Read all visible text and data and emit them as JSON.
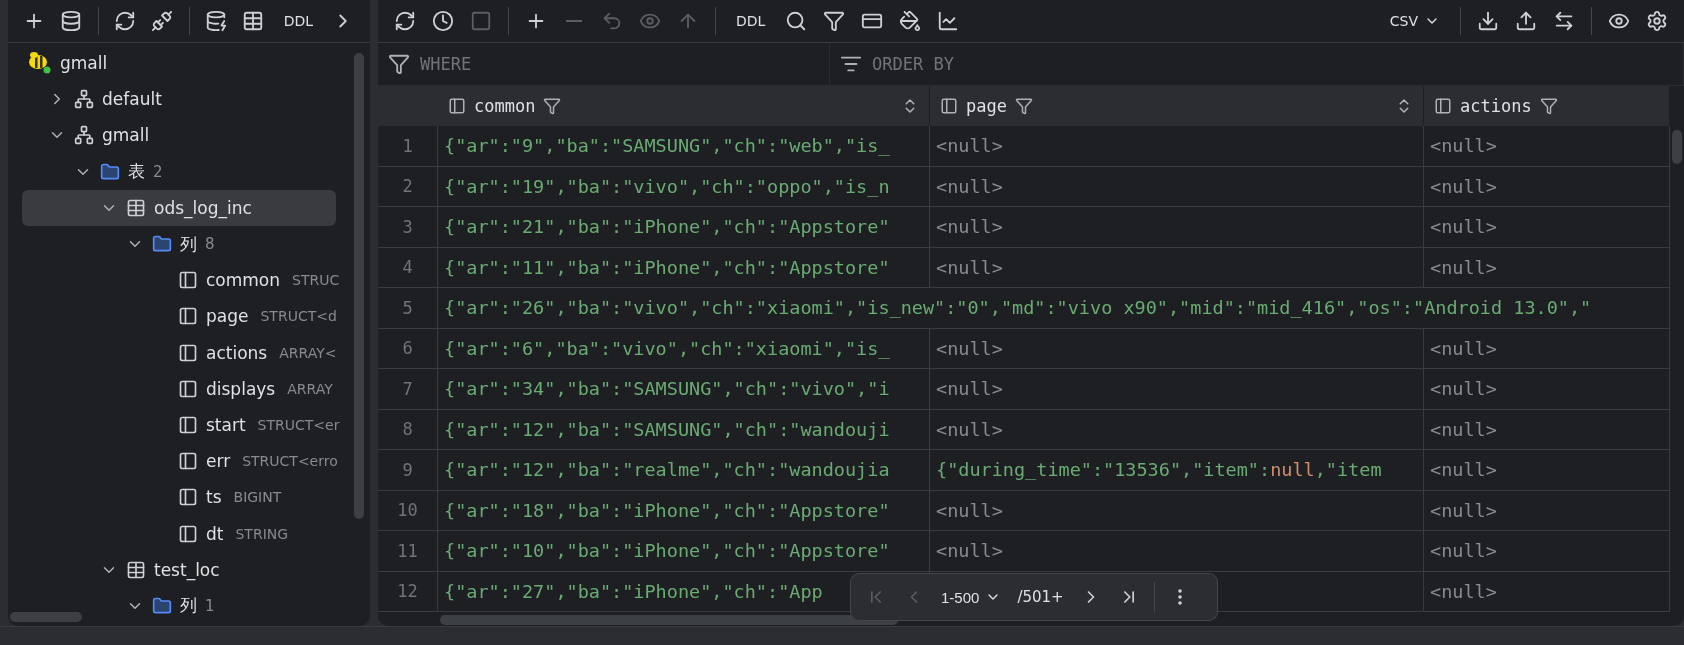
{
  "sidebar": {
    "toolbar": [
      {
        "kind": "icon"
      },
      {
        "kind": "icon"
      },
      {
        "kind": "divider"
      },
      {
        "kind": "icon"
      },
      {
        "kind": "icon"
      },
      {
        "kind": "divider"
      },
      {
        "kind": "icon"
      },
      {
        "kind": "icon"
      },
      {
        "kind": "text",
        "label": "DDL"
      },
      {
        "kind": "icon"
      }
    ],
    "tree": [
      {
        "kind": "database",
        "label": "gmall",
        "selected": false,
        "children": [
          {
            "kind": "schema",
            "label": "default",
            "expanded": false,
            "selected": false
          },
          {
            "kind": "schema",
            "label": "gmall",
            "expanded": true,
            "selected": false,
            "children": [
              {
                "kind": "folder",
                "label": "表",
                "count": "2",
                "expanded": true,
                "selected": false,
                "children": [
                  {
                    "kind": "table",
                    "label": "ods_log_inc",
                    "expanded": true,
                    "selected": true,
                    "children": [
                      {
                        "kind": "folder",
                        "label": "列",
                        "count": "8",
                        "expanded": true,
                        "selected": false,
                        "children": [
                          {
                            "kind": "column",
                            "label": "common",
                            "type": "STRUC",
                            "selected": false
                          },
                          {
                            "kind": "column",
                            "label": "page",
                            "type": "STRUCT<d",
                            "selected": false
                          },
                          {
                            "kind": "column",
                            "label": "actions",
                            "type": "ARRAY<",
                            "selected": false
                          },
                          {
                            "kind": "column",
                            "label": "displays",
                            "type": "ARRAY",
                            "selected": false
                          },
                          {
                            "kind": "column",
                            "label": "start",
                            "type": "STRUCT<er",
                            "selected": false
                          },
                          {
                            "kind": "column",
                            "label": "err",
                            "type": "STRUCT<erro",
                            "selected": false
                          },
                          {
                            "kind": "column",
                            "label": "ts",
                            "type": "BIGINT",
                            "selected": false
                          },
                          {
                            "kind": "column",
                            "label": "dt",
                            "type": "STRING",
                            "selected": false
                          }
                        ]
                      }
                    ]
                  },
                  {
                    "kind": "table",
                    "label": "test_loc",
                    "expanded": true,
                    "selected": false,
                    "children": [
                      {
                        "kind": "folder",
                        "label": "列",
                        "count": "1",
                        "expanded": true,
                        "selected": false
                      }
                    ]
                  }
                ]
              }
            ]
          }
        ]
      }
    ]
  },
  "toolbar": [
    {
      "kind": "icon",
      "disabled": false
    },
    {
      "kind": "icon",
      "disabled": false
    },
    {
      "kind": "icon",
      "disabled": true
    },
    {
      "kind": "divider"
    },
    {
      "kind": "icon",
      "disabled": false
    },
    {
      "kind": "icon",
      "disabled": true
    },
    {
      "kind": "icon",
      "disabled": true
    },
    {
      "kind": "icon",
      "disabled": true
    },
    {
      "kind": "icon",
      "disabled": true
    },
    {
      "kind": "divider"
    },
    {
      "kind": "text",
      "label": "DDL",
      "disabled": false
    },
    {
      "kind": "icon",
      "disabled": false
    },
    {
      "kind": "icon",
      "disabled": false
    },
    {
      "kind": "icon",
      "disabled": false
    },
    {
      "kind": "icon",
      "disabled": false
    },
    {
      "kind": "icon",
      "disabled": false
    },
    {
      "kind": "spacer"
    },
    {
      "kind": "dropdown",
      "label": "CSV",
      "disabled": false
    },
    {
      "kind": "divider"
    },
    {
      "kind": "icon",
      "disabled": false
    },
    {
      "kind": "icon",
      "disabled": false
    },
    {
      "kind": "icon",
      "disabled": false
    },
    {
      "kind": "divider"
    },
    {
      "kind": "icon",
      "disabled": false
    },
    {
      "kind": "icon",
      "disabled": false
    }
  ],
  "filters": {
    "where": {
      "placeholder": "WHERE"
    },
    "order_by": {
      "placeholder": "ORDER BY"
    }
  },
  "table": {
    "columns": [
      {
        "name": "common",
        "sortable": true
      },
      {
        "name": "page",
        "sortable": true
      },
      {
        "name": "actions",
        "sortable": false
      }
    ],
    "rows": [
      {
        "number": "1",
        "kind": "normal",
        "cells": [
          {
            "segments": [
              {
                "text": "{\"ar\":\"9\",\"ba\":\"SAMSUNG\",\"ch\":\"web\",\"is_",
                "kind": "json"
              }
            ]
          },
          {
            "segments": [
              {
                "text": "<null>",
                "kind": "null"
              }
            ]
          },
          {
            "segments": [
              {
                "text": "<null>",
                "kind": "null"
              }
            ]
          }
        ]
      },
      {
        "number": "2",
        "kind": "normal",
        "cells": [
          {
            "segments": [
              {
                "text": "{\"ar\":\"19\",\"ba\":\"vivo\",\"ch\":\"oppo\",\"is_n",
                "kind": "json"
              }
            ]
          },
          {
            "segments": [
              {
                "text": "<null>",
                "kind": "null"
              }
            ]
          },
          {
            "segments": [
              {
                "text": "<null>",
                "kind": "null"
              }
            ]
          }
        ]
      },
      {
        "number": "3",
        "kind": "normal",
        "cells": [
          {
            "segments": [
              {
                "text": "{\"ar\":\"21\",\"ba\":\"iPhone\",\"ch\":\"Appstore\"",
                "kind": "json"
              }
            ]
          },
          {
            "segments": [
              {
                "text": "<null>",
                "kind": "null"
              }
            ]
          },
          {
            "segments": [
              {
                "text": "<null>",
                "kind": "null"
              }
            ]
          }
        ]
      },
      {
        "number": "4",
        "kind": "normal",
        "cells": [
          {
            "segments": [
              {
                "text": "{\"ar\":\"11\",\"ba\":\"iPhone\",\"ch\":\"Appstore\"",
                "kind": "json"
              }
            ]
          },
          {
            "segments": [
              {
                "text": "<null>",
                "kind": "null"
              }
            ]
          },
          {
            "segments": [
              {
                "text": "<null>",
                "kind": "null"
              }
            ]
          }
        ]
      },
      {
        "number": "5",
        "kind": "wide",
        "cells": [
          {
            "segments": [
              {
                "text": "{\"ar\":\"26\",\"ba\":\"vivo\",\"ch\":\"xiaomi\",\"is_new\":\"0\",\"md\":\"vivo x90\",\"mid\":\"mid_416\",\"os\":\"Android 13.0\",\"",
                "kind": "json"
              }
            ]
          }
        ]
      },
      {
        "number": "6",
        "kind": "normal",
        "cells": [
          {
            "segments": [
              {
                "text": "{\"ar\":\"6\",\"ba\":\"vivo\",\"ch\":\"xiaomi\",\"is_",
                "kind": "json"
              }
            ]
          },
          {
            "segments": [
              {
                "text": "<null>",
                "kind": "null"
              }
            ]
          },
          {
            "segments": [
              {
                "text": "<null>",
                "kind": "null"
              }
            ]
          }
        ]
      },
      {
        "number": "7",
        "kind": "normal",
        "cells": [
          {
            "segments": [
              {
                "text": "{\"ar\":\"34\",\"ba\":\"SAMSUNG\",\"ch\":\"vivo\",\"i",
                "kind": "json"
              }
            ]
          },
          {
            "segments": [
              {
                "text": "<null>",
                "kind": "null"
              }
            ]
          },
          {
            "segments": [
              {
                "text": "<null>",
                "kind": "null"
              }
            ]
          }
        ]
      },
      {
        "number": "8",
        "kind": "normal",
        "cells": [
          {
            "segments": [
              {
                "text": "{\"ar\":\"12\",\"ba\":\"SAMSUNG\",\"ch\":\"wandouji",
                "kind": "json"
              }
            ]
          },
          {
            "segments": [
              {
                "text": "<null>",
                "kind": "null"
              }
            ]
          },
          {
            "segments": [
              {
                "text": "<null>",
                "kind": "null"
              }
            ]
          }
        ]
      },
      {
        "number": "9",
        "kind": "normal",
        "cells": [
          {
            "segments": [
              {
                "text": "{\"ar\":\"12\",\"ba\":\"realme\",\"ch\":\"wandoujia",
                "kind": "json"
              }
            ]
          },
          {
            "segments": [
              {
                "text": "{\"during_time\":\"13536\",\"item\":",
                "kind": "json"
              },
              {
                "text": "null",
                "kind": "literal"
              },
              {
                "text": ",\"item",
                "kind": "json"
              }
            ]
          },
          {
            "segments": [
              {
                "text": "<null>",
                "kind": "null"
              }
            ]
          }
        ]
      },
      {
        "number": "10",
        "kind": "normal",
        "cells": [
          {
            "segments": [
              {
                "text": "{\"ar\":\"18\",\"ba\":\"iPhone\",\"ch\":\"Appstore\"",
                "kind": "json"
              }
            ]
          },
          {
            "segments": [
              {
                "text": "<null>",
                "kind": "null"
              }
            ]
          },
          {
            "segments": [
              {
                "text": "<null>",
                "kind": "null"
              }
            ]
          }
        ]
      },
      {
        "number": "11",
        "kind": "normal",
        "cells": [
          {
            "segments": [
              {
                "text": "{\"ar\":\"10\",\"ba\":\"iPhone\",\"ch\":\"Appstore\"",
                "kind": "json"
              }
            ]
          },
          {
            "segments": [
              {
                "text": "<null>",
                "kind": "null"
              }
            ]
          },
          {
            "segments": [
              {
                "text": "<null>",
                "kind": "null"
              }
            ]
          }
        ]
      },
      {
        "number": "12",
        "kind": "normal",
        "cells": [
          {
            "segments": [
              {
                "text": "{\"ar\":\"27\",\"ba\":\"iPhone\",\"ch\":\"App",
                "kind": "json"
              }
            ]
          },
          "",
          {
            "segments": [
              {
                "text": "<null>",
                "kind": "null"
              }
            ]
          }
        ]
      }
    ]
  },
  "pagination": {
    "first": {
      "disabled": true
    },
    "previous": {
      "disabled": true
    },
    "range": "1-500",
    "total": "/501+",
    "next": {
      "disabled": false
    },
    "last": {
      "disabled": false
    }
  }
}
